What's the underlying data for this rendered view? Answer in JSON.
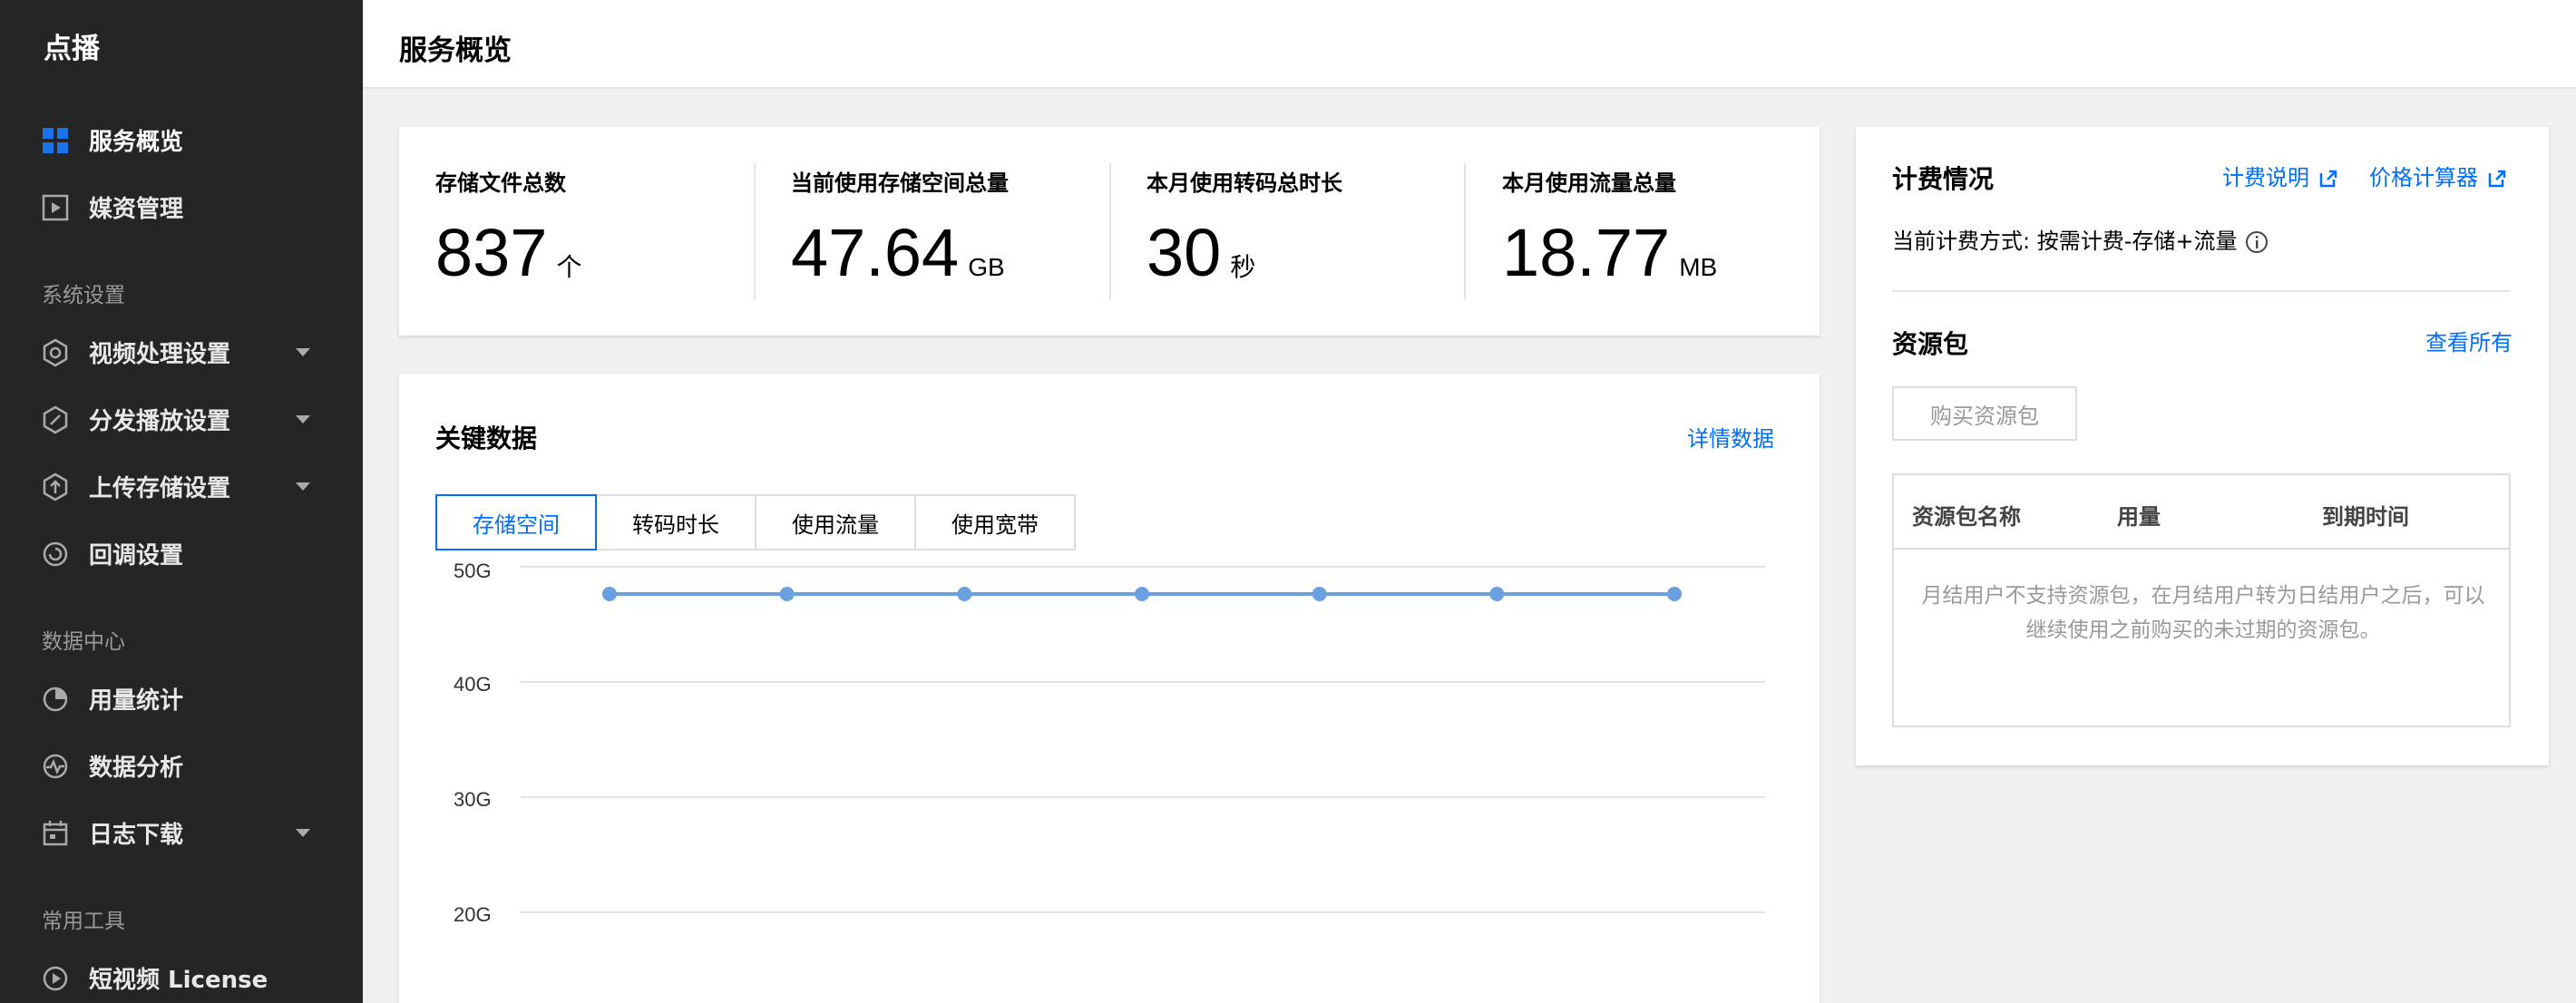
{
  "sidebar": {
    "app_title": "点播",
    "items": [
      {
        "label": "服务概览",
        "active": true
      },
      {
        "label": "媒资管理"
      },
      {
        "group": "系统设置"
      },
      {
        "label": "视频处理设置",
        "caret": true
      },
      {
        "label": "分发播放设置",
        "caret": true
      },
      {
        "label": "上传存储设置",
        "caret": true
      },
      {
        "label": "回调设置"
      },
      {
        "group": "数据中心"
      },
      {
        "label": "用量统计"
      },
      {
        "label": "数据分析"
      },
      {
        "label": "日志下载",
        "caret": true
      },
      {
        "group": "常用工具"
      },
      {
        "label": "短视频 License"
      }
    ]
  },
  "header": {
    "title": "服务概览"
  },
  "stats": [
    {
      "label": "存储文件总数",
      "value": "837",
      "unit": "个"
    },
    {
      "label": "当前使用存储空间总量",
      "value": "47.64",
      "unit": "GB"
    },
    {
      "label": "本月使用转码总时长",
      "value": "30",
      "unit": "秒"
    },
    {
      "label": "本月使用流量总量",
      "value": "18.77",
      "unit": "MB"
    }
  ],
  "key_data": {
    "title": "关键数据",
    "detail_link": "详情数据",
    "tabs": [
      "存储空间",
      "转码时长",
      "使用流量",
      "使用宽带"
    ],
    "active_tab": 0
  },
  "chart_data": {
    "type": "line",
    "y_ticks": [
      "50G",
      "40G",
      "30G",
      "20G"
    ],
    "ylim_visible": [
      20,
      50
    ],
    "series": [
      {
        "values": [
          47.64,
          47.64,
          47.64,
          47.64,
          47.64,
          47.64,
          47.64
        ]
      }
    ],
    "grid": true,
    "color": "#6a9fe0"
  },
  "billing": {
    "title": "计费情况",
    "link_explain": "计费说明",
    "link_calc": "价格计算器",
    "mode": "当前计费方式: 按需计费-存储+流量"
  },
  "resource_pack": {
    "title": "资源包",
    "view_all": "查看所有",
    "buy_button": "购买资源包",
    "columns": [
      "资源包名称",
      "用量",
      "到期时间"
    ],
    "empty_text": "月结用户不支持资源包，在月结用户转为日结用户之后，可以继续使用之前购买的未过期的资源包。"
  },
  "colors": {
    "accent": "#006eff",
    "sidebar_bg": "#252525"
  }
}
